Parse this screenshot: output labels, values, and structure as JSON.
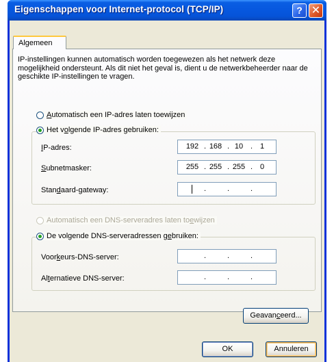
{
  "window": {
    "title": "Eigenschappen voor Internet-protocol (TCP/IP)",
    "help_glyph": "?",
    "close_glyph": "✕"
  },
  "tabs": [
    {
      "label": "Algemeen",
      "selected": true
    }
  ],
  "intro": "IP-instellingen kunnen automatisch worden toegewezen als het netwerk deze mogelijkheid ondersteunt. Als dit niet het geval is, dient u de netwerkbeheerder naar de geschikte IP-instellingen te vragen.",
  "ip": {
    "auto_radio": {
      "pre": "",
      "ul": "A",
      "post": "utomatisch een IP-adres laten toewijzen",
      "selected": false
    },
    "manual_radio": {
      "pre": "Het v",
      "ul": "o",
      "post": "lgende IP-adres gebruiken:",
      "selected": true
    },
    "fields": [
      {
        "pre": "",
        "ul": "I",
        "post": "P-adres:",
        "octets": [
          "192",
          "168",
          "10",
          "1"
        ]
      },
      {
        "pre": "",
        "ul": "S",
        "post": "ubnetmasker:",
        "octets": [
          "255",
          "255",
          "255",
          "0"
        ]
      },
      {
        "pre": "Stan",
        "ul": "d",
        "post": "aard-gateway:",
        "octets": [
          "",
          "",
          "",
          ""
        ]
      }
    ]
  },
  "dns": {
    "auto_radio": {
      "pre": "Automatisch een DNS-serveradres laten to",
      "ul": "e",
      "post": "wijzen",
      "selected": false,
      "disabled": true
    },
    "manual_radio": {
      "pre": "De volgende DNS-serveradressen g",
      "ul": "e",
      "post": "bruiken:",
      "selected": true
    },
    "fields": [
      {
        "pre": "Voor",
        "ul": "k",
        "post": "eurs-DNS-server:",
        "octets": [
          "",
          "",
          "",
          ""
        ]
      },
      {
        "pre": "Al",
        "ul": "t",
        "post": "ernatieve DNS-server:",
        "octets": [
          "",
          "",
          "",
          ""
        ]
      }
    ]
  },
  "advanced_button": {
    "pre": "Geavan",
    "ul": "c",
    "post": "eerd..."
  },
  "ok_button": "OK",
  "cancel_button": "Annuleren",
  "octet_separator": "."
}
